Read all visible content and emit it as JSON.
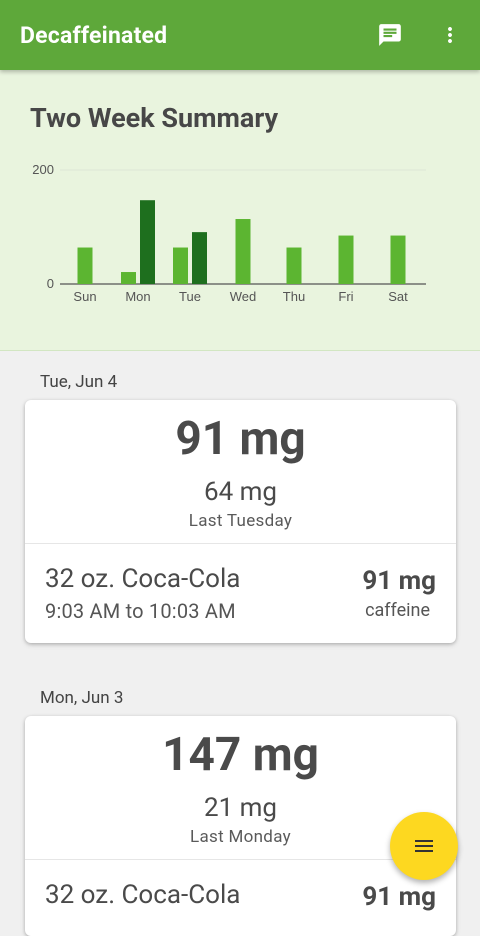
{
  "app": {
    "title": "Decaffeinated"
  },
  "icons": {
    "chat": "chat-icon",
    "more": "more-vert-icon",
    "fab": "menu-icon"
  },
  "colors": {
    "primary": "#5ea83a",
    "last_week_bar": "#5cb531",
    "this_week_bar": "#1e6f1e",
    "fab": "#fdd820"
  },
  "summary": {
    "title": "Two Week Summary"
  },
  "chart_data": {
    "type": "bar",
    "categories": [
      "Sun",
      "Mon",
      "Tue",
      "Wed",
      "Thu",
      "Fri",
      "Sat"
    ],
    "series": [
      {
        "values": [
          64,
          21,
          64,
          114,
          64,
          85,
          85
        ]
      },
      {
        "values": [
          null,
          147,
          91,
          null,
          null,
          null,
          null
        ]
      }
    ],
    "yticks": [
      "200",
      "0"
    ],
    "ylim": [
      0,
      200
    ]
  },
  "days": [
    {
      "date": "Tue, Jun 4",
      "total": "91 mg",
      "compare_value": "64 mg",
      "compare_label": "Last Tuesday",
      "entries": [
        {
          "drink": "32 oz. Coca-Cola",
          "time": "9:03 AM to 10:03 AM",
          "amount": "91 mg",
          "unit": "caffeine"
        }
      ]
    },
    {
      "date": "Mon, Jun 3",
      "total": "147 mg",
      "compare_value": "21 mg",
      "compare_label": "Last Monday",
      "entries": [
        {
          "drink": "32 oz. Coca-Cola",
          "amount": "91 mg"
        }
      ]
    }
  ]
}
